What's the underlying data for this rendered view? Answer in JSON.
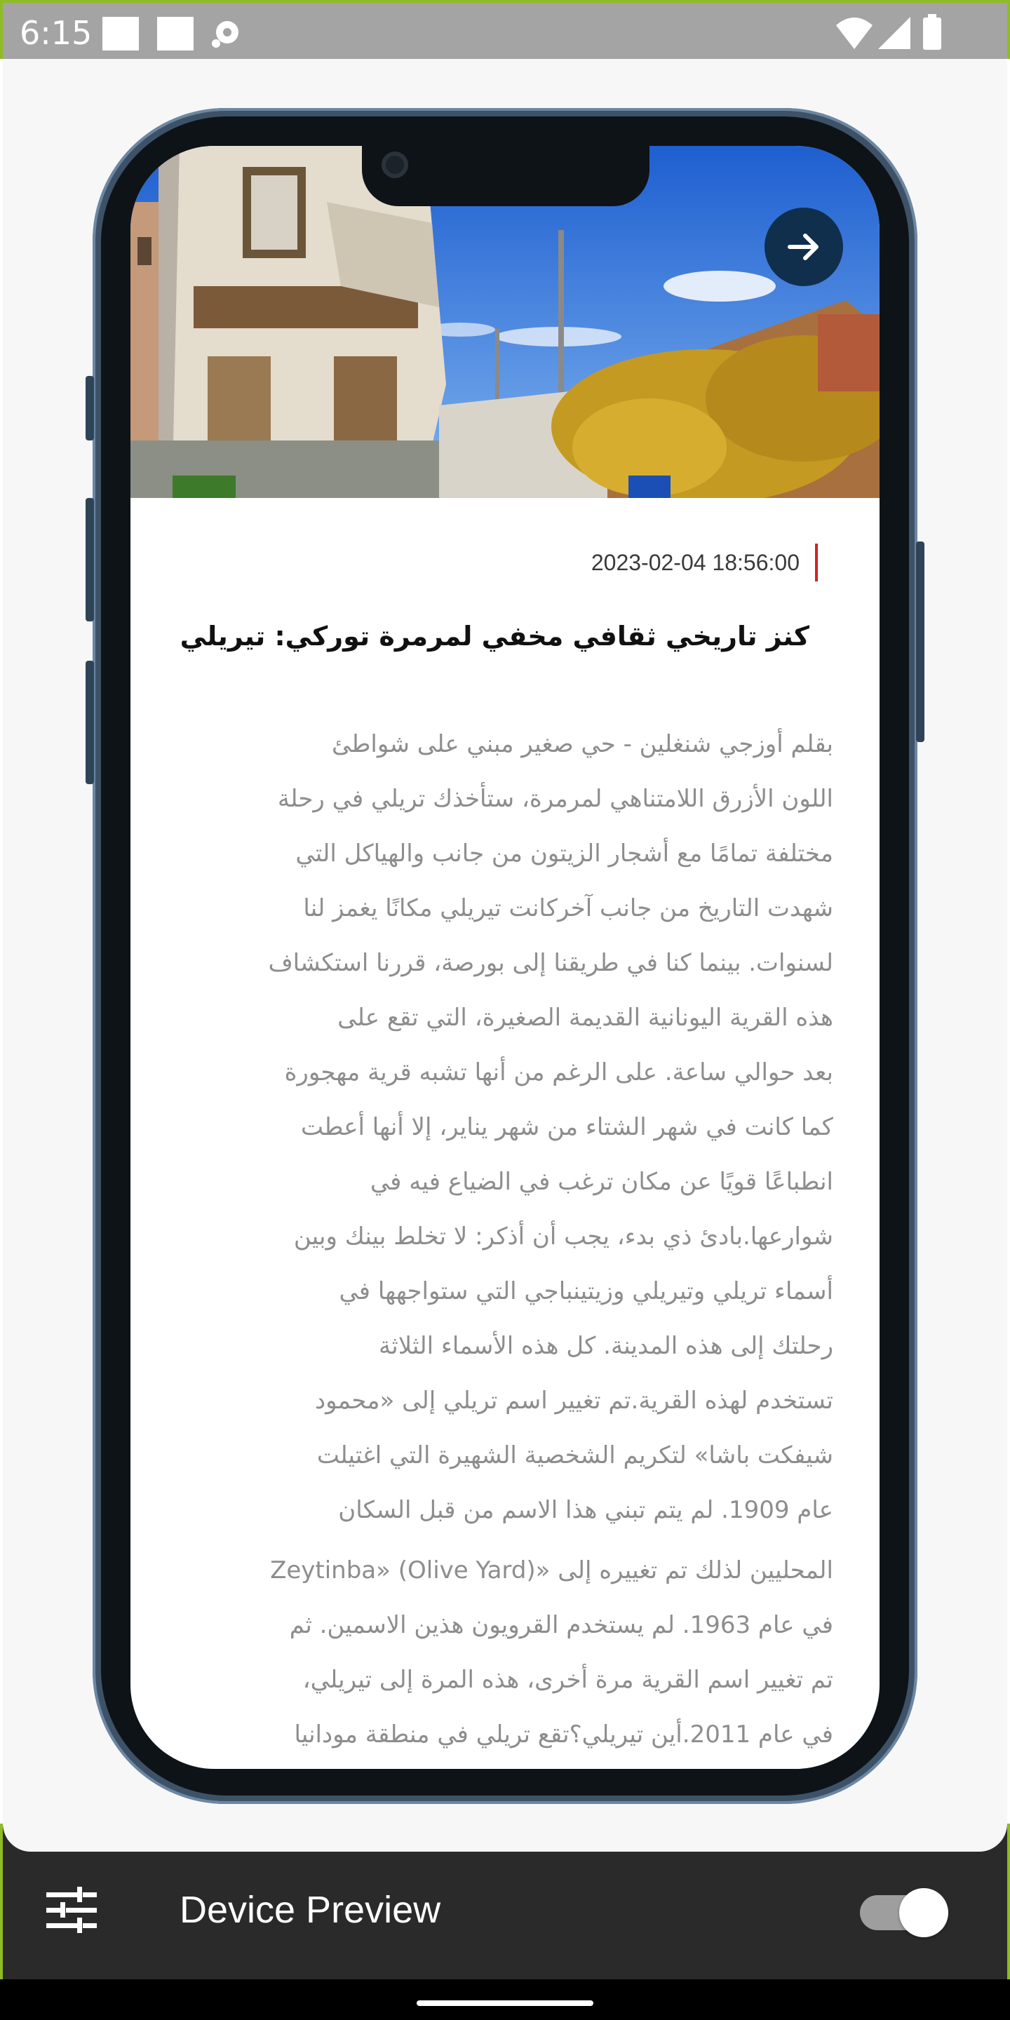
{
  "status_bar": {
    "time": "6:15"
  },
  "device_preview": {
    "title": "Device Preview",
    "toggle_on": true,
    "icons": [
      "settings-sliders-icon"
    ]
  },
  "article": {
    "datetime": "2023-02-04 18:56:00",
    "title": "كنز تاريخي ثقافي مخفي لمرمرة توركي: تيريلي",
    "body_lines": [
      "بقلم أوزجي شنغلين - حي صغير مبني على شواطئ",
      "اللون الأزرق اللامتناهي لمرمرة، ستأخذك تريلي في رحلة",
      "مختلفة تمامًا مع أشجار الزيتون من جانب والهياكل التي",
      "شهدت التاريخ من جانب آخركانت تيريلي مكانًا يغمز لنا",
      "لسنوات. بينما كنا في طريقنا إلى بورصة، قررنا استكشاف",
      "هذه القرية اليونانية القديمة الصغيرة، التي تقع على",
      "بعد حوالي ساعة. على الرغم من أنها تشبه قرية مهجورة",
      "كما كانت في شهر الشتاء من شهر يناير، إلا أنها أعطت",
      "انطباعًا قويًا عن مكان ترغب في الضياع فيه في",
      "شوارعها.بادئ ذي بدء، يجب أن أذكر: لا تخلط بينك وبين",
      "أسماء تريلي وتيريلي وزيتينباجي التي ستواجهها في",
      "رحلتك إلى هذه المدينة. كل هذه الأسماء الثلاثة",
      "تستخدم لهذه القرية.تم تغيير اسم تريلي إلى «محمود",
      "شيفكت باشا» لتكريم الشخصية الشهيرة التي اغتيلت",
      "عام 1909. لم يتم تبني هذا الاسم من قبل السكان",
      "المحليين لذلك تم تغييره إلى «Zeytinba» (Olive Yard)",
      "في عام 1963. لم يستخدم القرويون هذين الاسمين. ثم",
      "تم تغيير اسم القرية مرة أخرى، هذه المرة إلى تيريلي،",
      "في عام 2011.أين تيريلي؟تقع تريلي في منطقة مودانيا"
    ]
  },
  "colors": {
    "status_bar": "#a4a4a4",
    "bottom_bar": "#2a2a2a",
    "accent_line": "#d32222",
    "arrow_button": "#0f2f4d",
    "device_frame": "#3d5266"
  }
}
